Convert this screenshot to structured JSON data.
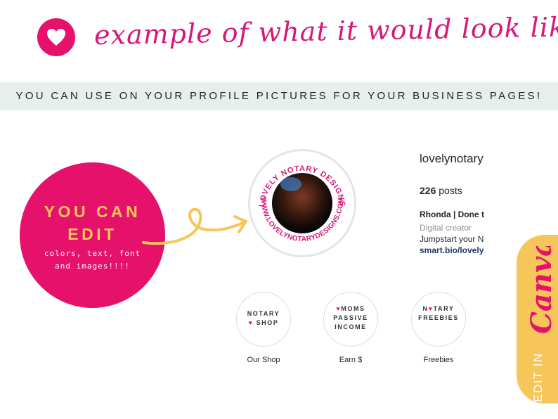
{
  "header": {
    "heart_icon": "heart-icon",
    "script_title": "example of what it would look like"
  },
  "banner": {
    "text": "YOU CAN USE ON YOUR PROFILE PICTURES FOR YOUR BUSINESS PAGES!"
  },
  "pink_circle": {
    "line1": "YOU CAN",
    "line2": "EDIT",
    "sub1": "colors, text, font",
    "sub2": "and images!!!!"
  },
  "profile": {
    "ring_text_top": "LOVELY NOTARY DESIGNS",
    "ring_text_bottom": "WWW.LOVELYNOTARYDESIGNS.COM",
    "username": "lovelynotary",
    "posts_count": "226",
    "posts_label": "posts",
    "bio_name": "Rhonda | Done t",
    "bio_category": "Digital creator",
    "bio_line": "Jumpstart your N",
    "bio_link": "smart.bio/lovely"
  },
  "highlights": [
    {
      "line1": "NOTARY",
      "line2": "SHOP",
      "label": "Our Shop"
    },
    {
      "line1": "MOMS",
      "line2": "PASSIVE",
      "line3": "INCOME",
      "label": "Earn $"
    },
    {
      "line1_a": "N",
      "line1_b": "TARY",
      "line2": "FREEBIES",
      "label": "Freebies"
    }
  ],
  "canva_tab": {
    "script": "Canva",
    "edit_in": "EDIT IN"
  },
  "colors": {
    "brand_pink": "#e5116a",
    "accent_yellow": "#f6c65a",
    "banner_bg": "#e6efec"
  }
}
